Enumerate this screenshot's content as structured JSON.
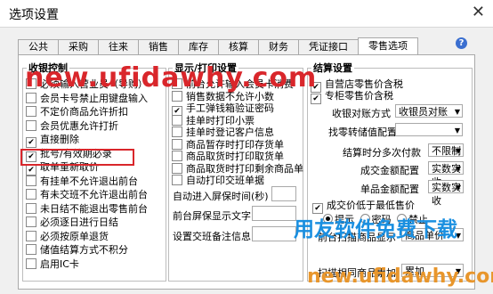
{
  "window": {
    "title": "选项设置"
  },
  "tabs": [
    "公共",
    "采购",
    "往来",
    "销售",
    "库存",
    "核算",
    "财务",
    "凭证接口",
    "零售选项"
  ],
  "retail": {
    "title": "收银控制",
    "items": [
      {
        "label": "必须输入营业员（导购）",
        "checked": false
      },
      {
        "label": "会员卡号禁止用键盘输入",
        "checked": false
      },
      {
        "label": "不定价商品允许折扣",
        "checked": false
      },
      {
        "label": "会员优惠允许打折",
        "checked": false
      },
      {
        "label": "直接删除",
        "checked": true
      },
      {
        "label": "批号/有效期必录",
        "checked": true
      },
      {
        "label": "取单重新取价",
        "checked": true
      },
      {
        "label": "有挂单不允许退出前台",
        "checked": false
      },
      {
        "label": "有未交班不允许退出前台",
        "checked": false
      },
      {
        "label": "未日结不能退出零售前台",
        "checked": false
      },
      {
        "label": "必须逐日进行日结",
        "checked": false
      },
      {
        "label": "必须按原单退货",
        "checked": false
      },
      {
        "label": "储值结算方式不积分",
        "checked": false
      },
      {
        "label": "启用IC卡",
        "checked": false
      }
    ]
  },
  "display": {
    "title": "显示/打印设置",
    "items": [
      {
        "label": "前台允许输入会员卡消费",
        "checked": false
      },
      {
        "label": "销售数据不允许小数",
        "checked": false
      },
      {
        "label": "手工弹钱箱验证密码",
        "checked": true
      },
      {
        "label": "挂单时打印小票",
        "checked": false
      },
      {
        "label": "挂单时登记客户信息",
        "checked": false
      },
      {
        "label": "商品暂存时打印存货单",
        "checked": false
      },
      {
        "label": "商品取货时打印取货单",
        "checked": false
      },
      {
        "label": "商品取货时打印剩余商品单",
        "checked": false
      },
      {
        "label": "自动打印交班单据",
        "checked": false
      }
    ],
    "autoscreen_label": "自动进入屏保时间(秒)",
    "screen_text_label": "前台屏保显示文字",
    "shift_info_label": "设置交班备注信息"
  },
  "settlement": {
    "title": "结算设置",
    "items": [
      {
        "label": "自营店零售价含税",
        "checked": true
      },
      {
        "label": "专柜零售价含税",
        "checked": true
      }
    ],
    "cashier_label": "收银对账方式",
    "cashier_value": "收银员对账",
    "change_label": "找零转储值配置",
    "multi_label": "结算时分多次付款",
    "multi_value": "不限制",
    "total_label": "成交金额配置",
    "total_value": "实数实收",
    "unit_label": "单品金额配置",
    "unit_value": "实数实收",
    "lowprice_label": "成交价低于最低售价",
    "lowprice_checked": true,
    "radio_options": [
      "提示",
      "密码",
      "禁止"
    ],
    "radio_selected": 0,
    "scan_label": "前台扫描商品显示",
    "scan_value": "商品单价",
    "scan_value2": "累加",
    "scan_label2": "扫描相同商品累加"
  },
  "watermarks": [
    "new.ufidawhy.com",
    "用友软件免费下载",
    "new.ufidawhy.com"
  ]
}
